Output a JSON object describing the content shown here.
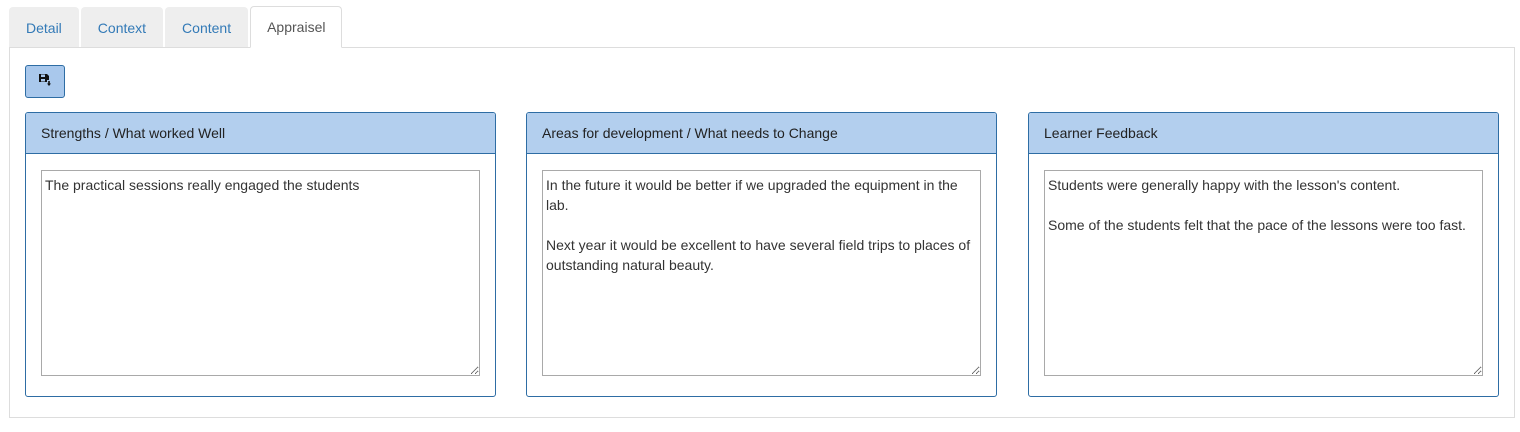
{
  "tabs": [
    {
      "label": "Detail"
    },
    {
      "label": "Context"
    },
    {
      "label": "Content"
    },
    {
      "label": "Appraisel"
    }
  ],
  "active_tab": "Appraisel",
  "toolbar": {
    "save_icon": "save-icon"
  },
  "panels": [
    {
      "title": "Strengths / What worked Well",
      "value": "The practical sessions really engaged the students"
    },
    {
      "title": "Areas for development / What needs to Change",
      "value": "In the future it would be better if we upgraded the equipment in the lab.\n\nNext year it would be excellent to have several field trips to places of outstanding natural beauty."
    },
    {
      "title": "Learner Feedback",
      "value": "Students were generally happy with the lesson's content.\n\nSome of the students felt that the pace of the lessons were too fast."
    }
  ],
  "colors": {
    "tab_link": "#337ab7",
    "panel_heading_bg": "#b3cfee",
    "panel_border": "#2e6da4",
    "button_bg": "#a9c8ec"
  }
}
